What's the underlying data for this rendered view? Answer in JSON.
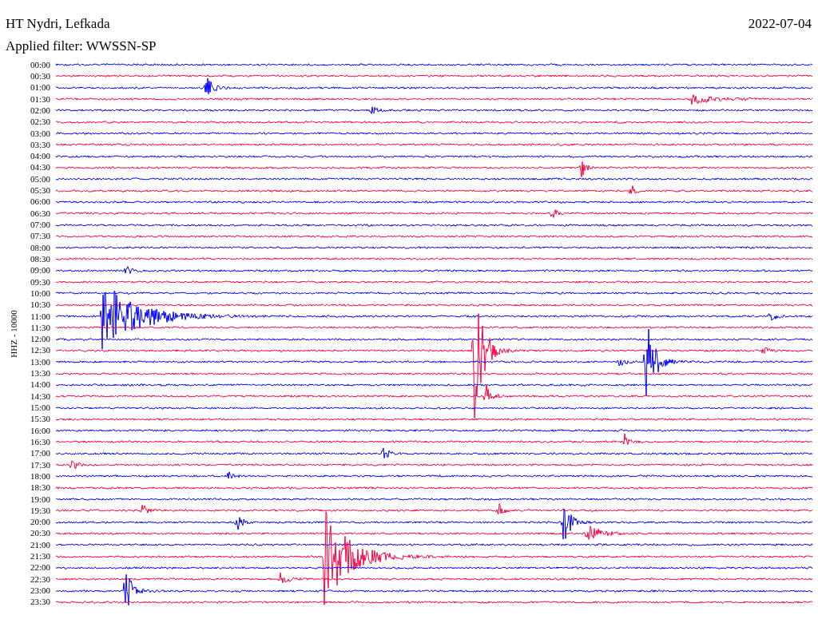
{
  "header": {
    "station": "HT Nydri, Lefkada",
    "date": "2022-07-04",
    "filter": "Applied filter: WWSSN-SP"
  },
  "axis_label": "HHZ - 10000",
  "rows": [
    {
      "time": "00:00",
      "color": "#0000ff"
    },
    {
      "time": "00:30",
      "color": "#ff0040"
    },
    {
      "time": "01:00",
      "color": "#0000ff"
    },
    {
      "time": "01:30",
      "color": "#ff0040"
    },
    {
      "time": "02:00",
      "color": "#0000ff"
    },
    {
      "time": "02:30",
      "color": "#ff0040"
    },
    {
      "time": "03:00",
      "color": "#0000ff"
    },
    {
      "time": "03:30",
      "color": "#ff0040"
    },
    {
      "time": "04:00",
      "color": "#0000ff"
    },
    {
      "time": "04:30",
      "color": "#ff0040"
    },
    {
      "time": "05:00",
      "color": "#0000ff"
    },
    {
      "time": "05:30",
      "color": "#ff0040"
    },
    {
      "time": "06:00",
      "color": "#0000ff"
    },
    {
      "time": "06:30",
      "color": "#ff0040"
    },
    {
      "time": "07:00",
      "color": "#0000ff"
    },
    {
      "time": "07:30",
      "color": "#ff0040"
    },
    {
      "time": "08:00",
      "color": "#0000ff"
    },
    {
      "time": "08:30",
      "color": "#ff0040"
    },
    {
      "time": "09:00",
      "color": "#0000ff"
    },
    {
      "time": "09:30",
      "color": "#ff0040"
    },
    {
      "time": "10:00",
      "color": "#0000ff"
    },
    {
      "time": "10:30",
      "color": "#ff0040"
    },
    {
      "time": "11:00",
      "color": "#0000ff"
    },
    {
      "time": "11:30",
      "color": "#ff0040"
    },
    {
      "time": "12:00",
      "color": "#0000ff"
    },
    {
      "time": "12:30",
      "color": "#ff0040"
    },
    {
      "time": "13:00",
      "color": "#0000ff"
    },
    {
      "time": "13:30",
      "color": "#ff0040"
    },
    {
      "time": "14:00",
      "color": "#0000ff"
    },
    {
      "time": "14:30",
      "color": "#ff0040"
    },
    {
      "time": "15:00",
      "color": "#0000ff"
    },
    {
      "time": "15:30",
      "color": "#ff0040"
    },
    {
      "time": "16:00",
      "color": "#0000ff"
    },
    {
      "time": "16:30",
      "color": "#ff0040"
    },
    {
      "time": "17:00",
      "color": "#0000ff"
    },
    {
      "time": "17:30",
      "color": "#ff0040"
    },
    {
      "time": "18:00",
      "color": "#0000ff"
    },
    {
      "time": "18:30",
      "color": "#ff0040"
    },
    {
      "time": "19:00",
      "color": "#0000ff"
    },
    {
      "time": "19:30",
      "color": "#ff0040"
    },
    {
      "time": "20:00",
      "color": "#0000ff"
    },
    {
      "time": "20:30",
      "color": "#ff0040"
    },
    {
      "time": "21:00",
      "color": "#0000ff"
    },
    {
      "time": "21:30",
      "color": "#ff0040"
    },
    {
      "time": "22:00",
      "color": "#0000ff"
    },
    {
      "time": "22:30",
      "color": "#ff0040"
    },
    {
      "time": "23:00",
      "color": "#0000ff"
    },
    {
      "time": "23:30",
      "color": "#ff0040"
    }
  ]
}
